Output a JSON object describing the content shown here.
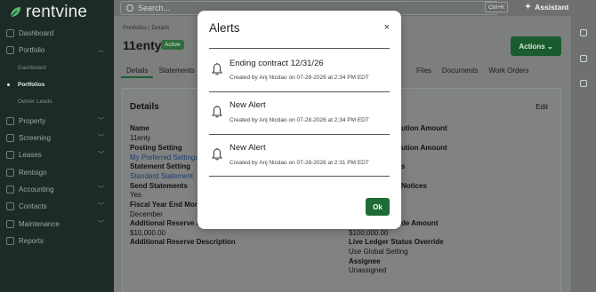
{
  "app": {
    "logo_text": "rentvine"
  },
  "sidebar": {
    "items": [
      {
        "label": "Dashboard",
        "icon": "grid-icon"
      },
      {
        "label": "Portfolio",
        "icon": "folder-icon"
      },
      {
        "label": "Property",
        "icon": "building-icon"
      },
      {
        "label": "Screening",
        "icon": "screening-icon"
      },
      {
        "label": "Leases",
        "icon": "lease-icon"
      },
      {
        "label": "Rentsign",
        "icon": "sign-icon"
      },
      {
        "label": "Accounting",
        "icon": "bank-icon"
      },
      {
        "label": "Contacts",
        "icon": "contacts-icon"
      },
      {
        "label": "Maintenance",
        "icon": "wrench-icon"
      },
      {
        "label": "Reports",
        "icon": "chart-icon"
      }
    ],
    "portfolio_sub": [
      "Dashboard",
      "Portfolios",
      "Owner Leads"
    ],
    "active_sub": "Portfolios"
  },
  "topbar": {
    "search_placeholder": "Search...",
    "shortcut": "Ctrl+K",
    "assistant": "Assistant"
  },
  "page": {
    "breadcrumb": "Portfolios  |  Details",
    "title": "11enty",
    "status": "Active",
    "actions_label": "Actions",
    "tabs": [
      "Details",
      "Statements"
    ],
    "tabs_right": [
      "Files",
      "Documents",
      "Work Orders"
    ],
    "card_title": "Details",
    "edit_label": "Edit",
    "left_fields": [
      {
        "text": "Name",
        "bold": true
      },
      {
        "text": "11enty",
        "bold": false
      },
      {
        "text": "Posting Setting",
        "bold": true
      },
      {
        "text": "My Preferred Settings",
        "link": true
      },
      {
        "text": "Statement Setting",
        "bold": true
      },
      {
        "text": "Standard Statement",
        "link": true
      },
      {
        "text": "Send Statements",
        "bold": true
      },
      {
        "text": "Yes",
        "bold": false
      },
      {
        "text": "Fiscal Year End Month",
        "bold": true
      },
      {
        "text": "December",
        "bold": false
      },
      {
        "text": "Additional Reserve Amount",
        "bold": true
      },
      {
        "text": "$10,000.00",
        "bold": false
      },
      {
        "text": "Additional Reserve Description",
        "bold": true
      }
    ],
    "right_fields": [
      {
        "text": "ution Amount",
        "bold": true
      },
      {
        "text": "ution Amount",
        "bold": true
      },
      {
        "text": "s",
        "bold": true
      },
      {
        "text": "Notices",
        "bold": true
      },
      {
        "text": "de Amount",
        "bold": true
      },
      {
        "text": "$100,000.00",
        "bold": false
      },
      {
        "text": "Live Ledger Status Override",
        "bold": true
      },
      {
        "text": "Use Global Setting",
        "bold": false
      },
      {
        "text": "Assignee",
        "bold": true
      },
      {
        "text": "Unassigned",
        "bold": false
      }
    ]
  },
  "modal": {
    "title": "Alerts",
    "close": "×",
    "alerts": [
      {
        "title": "Ending contract 12/31/26",
        "meta": "Created by Anj Nicdao on 07-28-2026 at 2:34 PM EDT"
      },
      {
        "title": "New Alert",
        "meta": "Created by Anj Nicdao on 07-28-2026 at 2:34 PM EDT"
      },
      {
        "title": "New Alert",
        "meta": "Created by Anj Nicdao on 07-28-2026 at 2:31 PM EDT"
      }
    ],
    "ok_label": "Ok"
  },
  "colors": {
    "sidebar": "#1d2b28",
    "primary": "#1f6b36",
    "overlay": "#7d7f7f"
  }
}
